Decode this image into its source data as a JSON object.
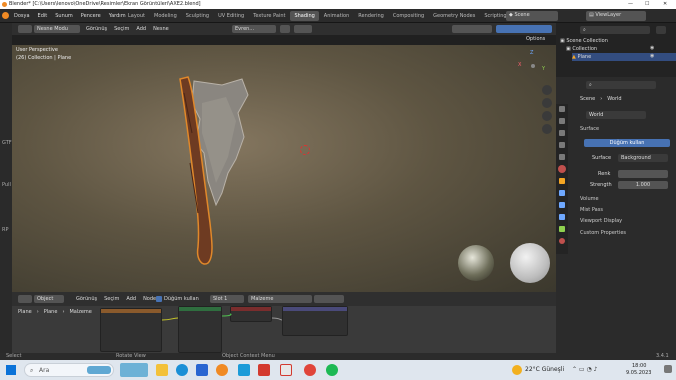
{
  "titlebar": {
    "title": "Blender* [C:\\Users\\lenovo\\OneDrive\\Resimler\\Ekran Görüntüleri\\AXE2.blend]",
    "min": "—",
    "max": "☐",
    "close": "✕"
  },
  "menubar": {
    "items": [
      "Dosya",
      "Edit",
      "Sunum",
      "Pencere",
      "Yardım"
    ],
    "workspaces": [
      "Layout",
      "Modeling",
      "Sculpting",
      "UV Editing",
      "Texture Paint",
      "Shading",
      "Animation",
      "Rendering",
      "Compositing",
      "Geometry Nodes",
      "Scripting"
    ],
    "active_workspace": "Shading",
    "add_tab": "+",
    "scene": "Scene",
    "viewlayer": "ViewLayer"
  },
  "viewport": {
    "header": {
      "mode": "Nesne Modu",
      "menus": [
        "Görünüş",
        "Seçim",
        "Add",
        "Nesne"
      ],
      "transform": "Evren...",
      "options": "Options"
    },
    "overlay_line1": "User Perspective",
    "overlay_line2": "(26) Collection | Plane",
    "gizmo": {
      "x": "X",
      "y": "Y",
      "z": "Z"
    }
  },
  "outliner": {
    "search_placeholder": "",
    "items": [
      {
        "label": "Scene Collection",
        "level": 0
      },
      {
        "label": "Collection",
        "level": 1
      },
      {
        "label": "Plane",
        "level": 2,
        "selected": true
      }
    ]
  },
  "properties": {
    "breadcrumb": [
      "Scene",
      "World"
    ],
    "world_name": "World",
    "surface_section": "Surface",
    "use_nodes_button": "Düğüm kullan",
    "surface_label": "Surface",
    "surface_value": "Background",
    "renk_label": "Renk",
    "strength_label": "Strength",
    "strength_value": "1.000",
    "sections": [
      "Volume",
      "Mist Pass",
      "Viewport Display",
      "Custom Properties"
    ]
  },
  "node_editor": {
    "header": {
      "type": "Object",
      "menus": [
        "Görünüş",
        "Seçim",
        "Add",
        "Node"
      ],
      "use_nodes": "Düğüm kullan",
      "slot": "Slot 1",
      "material": "Malzeme"
    },
    "breadcrumb": [
      "Plane",
      "Plane",
      "Malzeme"
    ]
  },
  "statusbar": {
    "left": "Select",
    "middle": "Rotate View",
    "right_hint": "Object Context Menu",
    "version": "3.4.1"
  },
  "taskbar": {
    "search_placeholder": "Ara",
    "weather": "22°C  Güneşli",
    "time": "18:00",
    "date": "9.05.2023",
    "pinned_apps": [
      "file-explorer",
      "edge",
      "store",
      "blender",
      "mail",
      "libre",
      "office",
      "chrome",
      "spotify"
    ]
  },
  "colors": {
    "accent": "#4772b3",
    "active_workspace": "#545454",
    "selection": "#f5a623",
    "panel": "#2b2b2b"
  }
}
